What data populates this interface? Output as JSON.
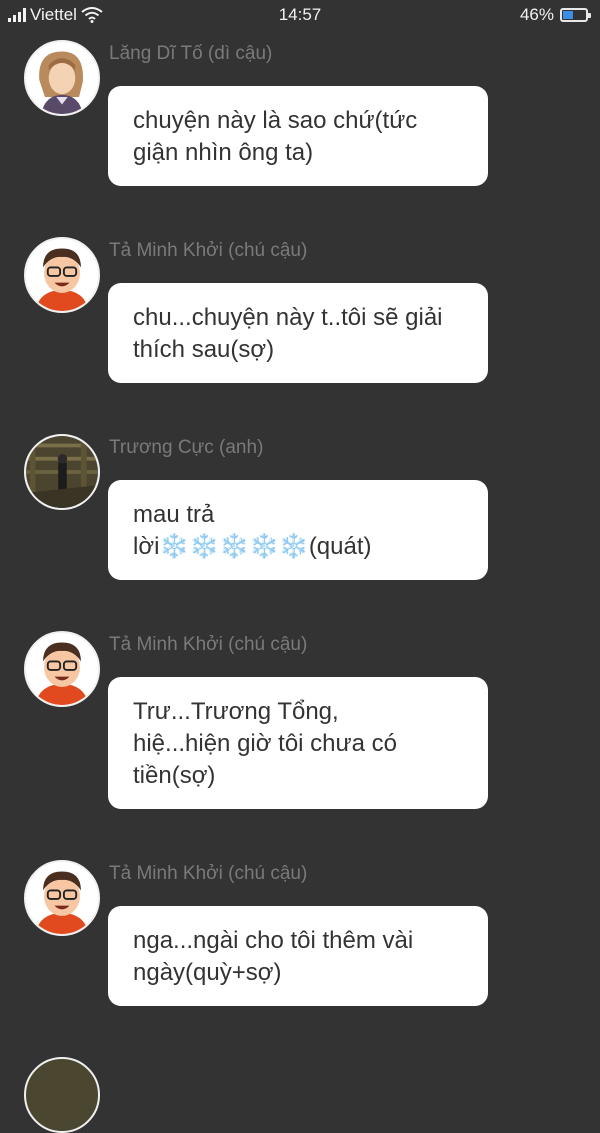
{
  "status_bar": {
    "carrier": "Viettel",
    "time": "14:57",
    "battery_text": "46%",
    "battery_level": 0.46,
    "battery_color": "#3a8ee6"
  },
  "messages": [
    {
      "sender": "Lăng Dĩ Tố (dì cậu)",
      "avatar": "woman-portrait-avatar",
      "text": "chuyện này là sao chứ(tức giận nhìn ông ta)"
    },
    {
      "sender": "Tả Minh Khởi (chú cậu)",
      "avatar": "man-glasses-avatar",
      "text": "chu...chuyện này t..tôi sẽ giải thích sau(sợ)"
    },
    {
      "sender": "Trương Cực (anh)",
      "avatar": "warehouse-photo-avatar",
      "text": "mau trả lời❄️❄️❄️❄️❄️(quát)"
    },
    {
      "sender": "Tả Minh Khởi (chú cậu)",
      "avatar": "man-glasses-avatar",
      "text": "Trư...Trương Tổng, hiệ...hiện giờ tôi chưa có tiền(sợ)"
    },
    {
      "sender": "Tả Minh Khởi (chú cậu)",
      "avatar": "man-glasses-avatar",
      "text": "nga...ngài cho tôi thêm vài ngày(quỳ+sợ)"
    }
  ],
  "colors": {
    "background": "#333333",
    "bubble": "#ffffff",
    "sender_text": "#7a7a7a",
    "message_text": "#333333"
  }
}
